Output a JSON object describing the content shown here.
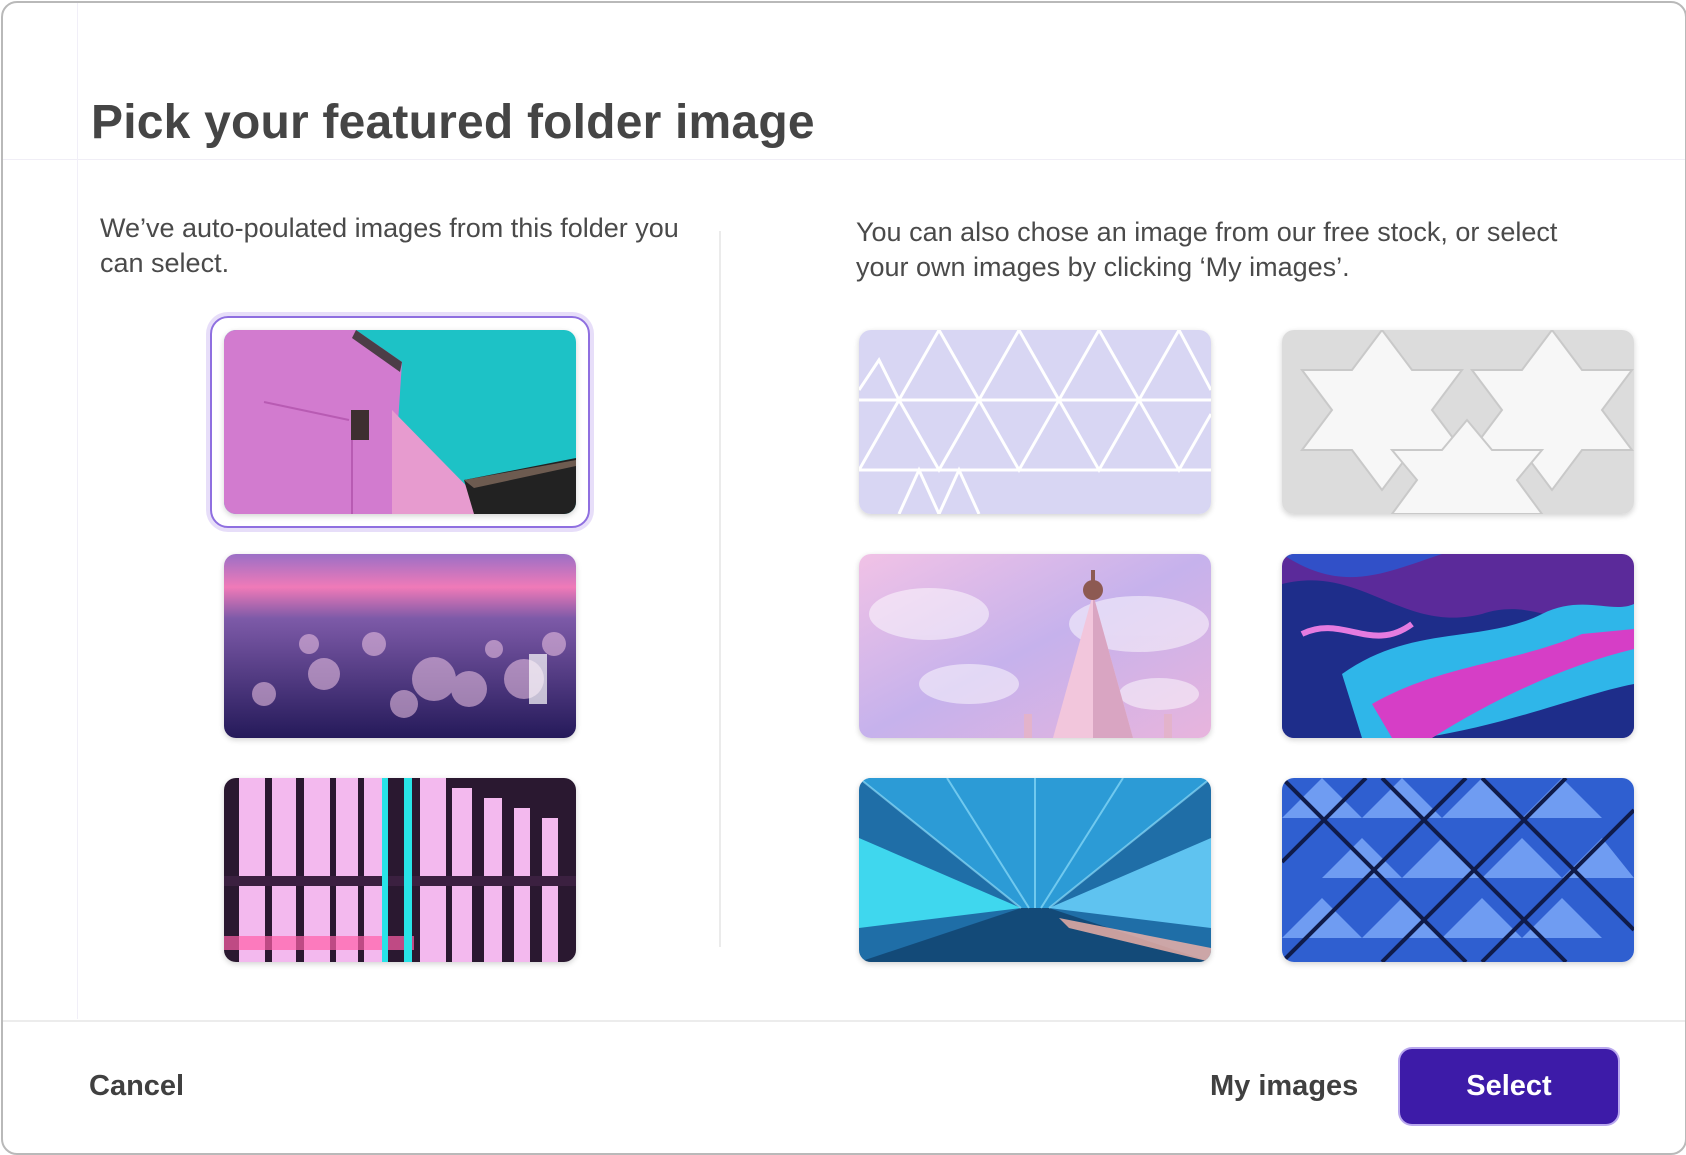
{
  "dialog": {
    "title": "Pick your featured folder image",
    "left_description": "We’ve auto-poulated images from this folder you can select.",
    "right_description": "You can also chose an image from our free stock, or select your own images by clicking ‘My images’."
  },
  "folder_images": [
    {
      "name": "pink-building-teal-sky",
      "selected": true
    },
    {
      "name": "purple-bokeh-city-lights",
      "selected": false
    },
    {
      "name": "pink-neon-tubes",
      "selected": false
    }
  ],
  "stock_images": [
    {
      "name": "lavender-triangle-dome"
    },
    {
      "name": "white-woven-3d-pattern"
    },
    {
      "name": "pink-spire-cloudy-sky"
    },
    {
      "name": "purple-blue-fluid-paint"
    },
    {
      "name": "blue-neon-tunnel"
    },
    {
      "name": "blue-geometric-ceiling"
    }
  ],
  "footer": {
    "cancel_label": "Cancel",
    "my_images_label": "My images",
    "select_label": "Select"
  },
  "colors": {
    "primary": "#3d1ba8",
    "selection_ring": "#8f6fe0",
    "border": "#b9b9b9"
  }
}
